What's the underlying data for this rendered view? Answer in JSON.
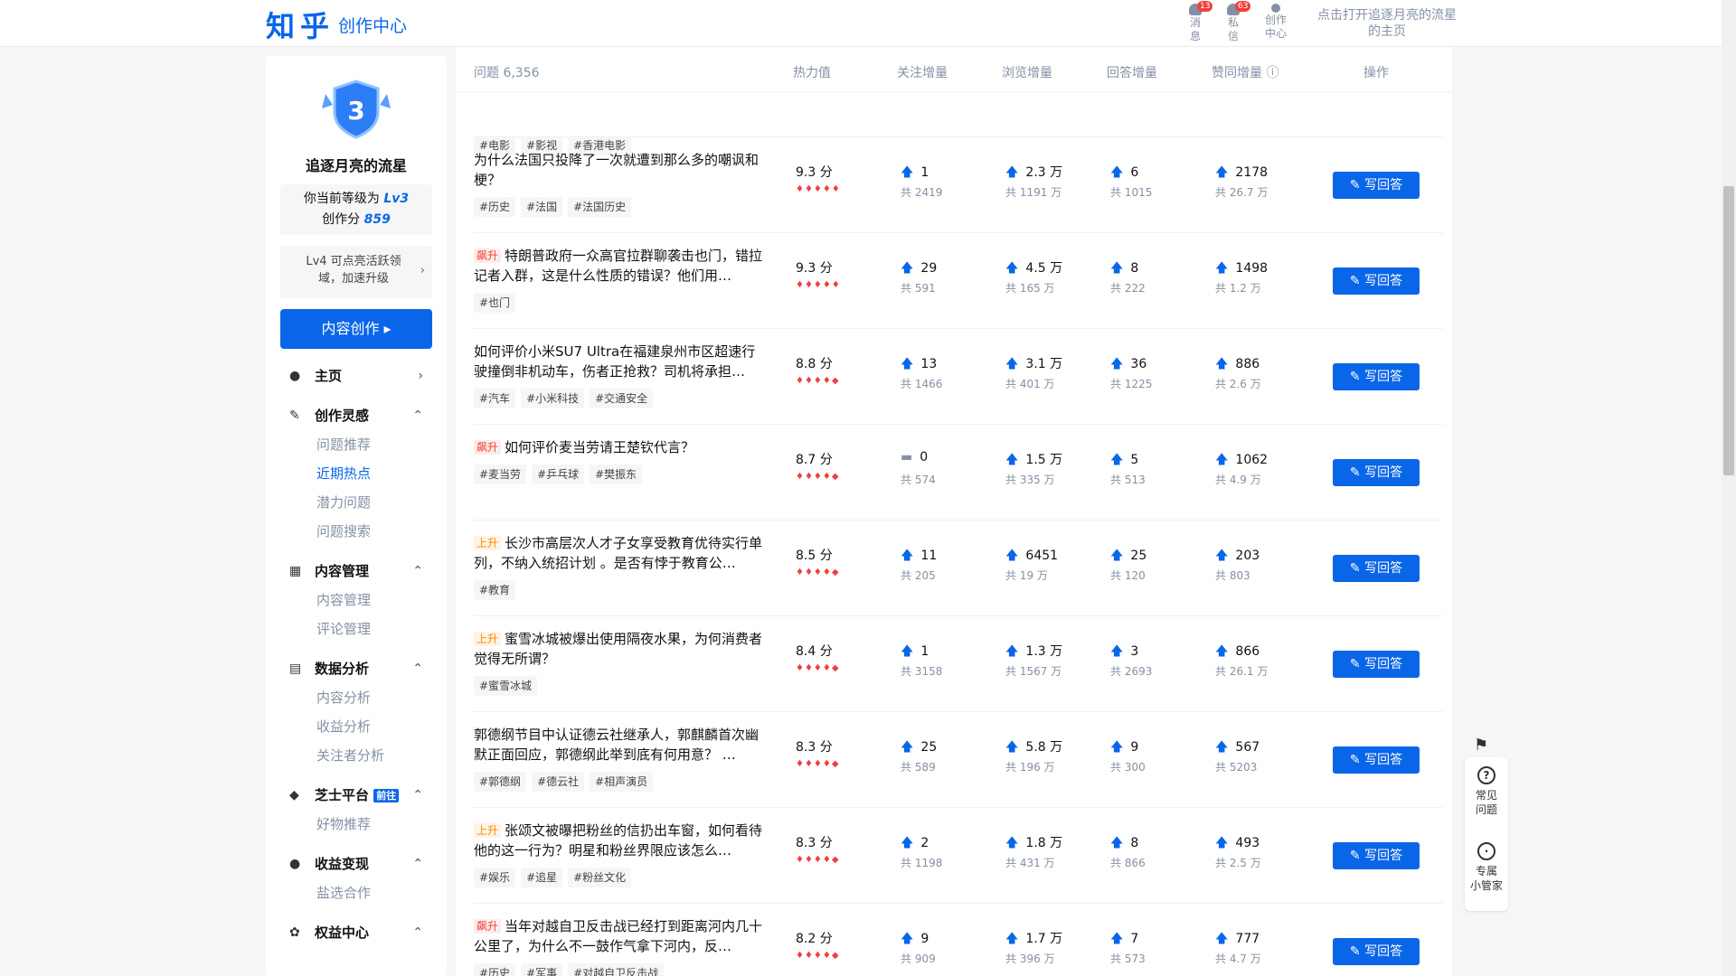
{
  "header": {
    "logo": "知乎",
    "subtitle": "创作中心",
    "icons": [
      {
        "label": "消\n息",
        "badge": "13"
      },
      {
        "label": "私\n信",
        "badge": "63"
      },
      {
        "label": "创作\n中心",
        "badge": ""
      }
    ],
    "avatar_alt": "点击打开追逐月亮的流星的主页"
  },
  "sidebar": {
    "level_badge": "3",
    "username": "追逐月亮的流星",
    "level_line_prefix": "你当前等级为",
    "level_value": "Lv3",
    "score_prefix": "创作分",
    "score_value": "859",
    "hint": "Lv4 可点亮活跃领域，加速升级",
    "create_button": "内容创作 ▸",
    "sections": [
      {
        "title": "主页",
        "icon": "person-icon",
        "chevron": "›",
        "items": []
      },
      {
        "title": "创作灵感",
        "icon": "pen-icon",
        "chevron": "⌃",
        "items": [
          "问题推荐",
          "近期热点",
          "潜力问题",
          "问题搜索"
        ]
      },
      {
        "title": "内容管理",
        "icon": "grid-icon",
        "chevron": "⌃",
        "items": [
          "内容管理",
          "评论管理"
        ]
      },
      {
        "title": "数据分析",
        "icon": "chart-icon",
        "chevron": "⌃",
        "items": [
          "内容分析",
          "收益分析",
          "关注者分析"
        ]
      },
      {
        "title": "芝士平台",
        "icon": "cheese-icon",
        "chevron": "⌃",
        "tag": "前往",
        "items": [
          "好物推荐"
        ]
      },
      {
        "title": "收益变现",
        "icon": "money-icon",
        "chevron": "⌃",
        "items": [
          "盐选合作"
        ]
      },
      {
        "title": "权益中心",
        "icon": "lotus-icon",
        "chevron": "⌃",
        "items": []
      }
    ],
    "active_item": "近期热点"
  },
  "table": {
    "headers": [
      "问题 6,356",
      "热力值",
      "关注增量",
      "浏览增量",
      "回答增量",
      "赞同增量 ⓘ",
      "操作"
    ],
    "top_tags": [
      "#电影",
      "#影视",
      "#香港电影"
    ],
    "write_label": "写回答",
    "rows": [
      {
        "badge": "",
        "title": "为什么法国只投降了一次就遭到那么多的嘲讽和梗？",
        "tags": [
          "#历史",
          "#法国",
          "#法国历史"
        ],
        "score": "9.3 分",
        "flames": "♦♦♦♦♦",
        "follow": "1",
        "follow_total": "共 2419",
        "follow_flat": false,
        "view": "2.3 万",
        "view_total": "共 1191 万",
        "answer": "6",
        "answer_total": "共 1015",
        "vote": "2178",
        "vote_total": "共 26.7 万"
      },
      {
        "badge": "飙升",
        "badge_type": "up",
        "title": "特朗普政府一众高官拉群聊袭击也门，错拉记者入群，这是什么性质的错误？他们用…",
        "tags": [
          "#也门"
        ],
        "score": "9.3 分",
        "flames": "♦♦♦♦♦",
        "follow": "29",
        "follow_total": "共 591",
        "follow_flat": false,
        "view": "4.5 万",
        "view_total": "共 165 万",
        "answer": "8",
        "answer_total": "共 222",
        "vote": "1498",
        "vote_total": "共 1.2 万"
      },
      {
        "badge": "",
        "title": "如何评价小米SU7 Ultra在福建泉州市区超速行驶撞倒非机动车，伤者正抢救？司机将承担…",
        "tags": [
          "#汽车",
          "#小米科技",
          "#交通安全"
        ],
        "score": "8.8 分",
        "flames": "♦♦♦♦◆",
        "follow": "13",
        "follow_total": "共 1466",
        "follow_flat": false,
        "view": "3.1 万",
        "view_total": "共 401 万",
        "answer": "36",
        "answer_total": "共 1225",
        "vote": "886",
        "vote_total": "共 2.6 万"
      },
      {
        "badge": "飙升",
        "badge_type": "up",
        "title": "如何评价麦当劳请王楚钦代言？",
        "tags": [
          "#麦当劳",
          "#乒乓球",
          "#樊振东"
        ],
        "score": "8.7 分",
        "flames": "♦♦♦♦◆",
        "follow": "0",
        "follow_total": "共 574",
        "follow_flat": true,
        "view": "1.5 万",
        "view_total": "共 335 万",
        "answer": "5",
        "answer_total": "共 513",
        "vote": "1062",
        "vote_total": "共 4.9 万"
      },
      {
        "badge": "上升",
        "badge_type": "rise",
        "title": "长沙市高层次人才子女享受教育优待实行单列，不纳入统招计划 。是否有悖于教育公…",
        "tags": [
          "#教育"
        ],
        "score": "8.5 分",
        "flames": "♦♦♦♦◆",
        "follow": "11",
        "follow_total": "共 205",
        "follow_flat": false,
        "view": "6451",
        "view_total": "共 19 万",
        "answer": "25",
        "answer_total": "共 120",
        "vote": "203",
        "vote_total": "共 803"
      },
      {
        "badge": "上升",
        "badge_type": "rise",
        "title": "蜜雪冰城被爆出使用隔夜水果，为何消费者觉得无所谓？",
        "tags": [
          "#蜜雪冰城"
        ],
        "score": "8.4 分",
        "flames": "♦♦♦♦◆",
        "follow": "1",
        "follow_total": "共 3158",
        "follow_flat": false,
        "view": "1.3 万",
        "view_total": "共 1567 万",
        "answer": "3",
        "answer_total": "共 2693",
        "vote": "866",
        "vote_total": "共 26.1 万"
      },
      {
        "badge": "",
        "title": "郭德纲节目中认证德云社继承人，郭麒麟首次幽默正面回应，郭德纲此举到底有何用意？ …",
        "tags": [
          "#郭德纲",
          "#德云社",
          "#相声演员"
        ],
        "score": "8.3 分",
        "flames": "♦♦♦♦◆",
        "follow": "25",
        "follow_total": "共 589",
        "follow_flat": false,
        "view": "5.8 万",
        "view_total": "共 196 万",
        "answer": "9",
        "answer_total": "共 300",
        "vote": "567",
        "vote_total": "共 5203"
      },
      {
        "badge": "上升",
        "badge_type": "rise",
        "title": "张颂文被曝把粉丝的信扔出车窗，如何看待他的这一行为？明星和粉丝界限应该怎么…",
        "tags": [
          "#娱乐",
          "#追星",
          "#粉丝文化"
        ],
        "score": "8.3 分",
        "flames": "♦♦♦♦◆",
        "follow": "2",
        "follow_total": "共 1198",
        "follow_flat": false,
        "view": "1.8 万",
        "view_total": "共 431 万",
        "answer": "8",
        "answer_total": "共 866",
        "vote": "493",
        "vote_total": "共 2.5 万"
      },
      {
        "badge": "飙升",
        "badge_type": "up",
        "title": "当年对越自卫反击战已经打到距离河内几十公里了，为什么不一鼓作气拿下河内，反…",
        "tags": [
          "#历史",
          "#军事",
          "#对越自卫反击战"
        ],
        "score": "8.2 分",
        "flames": "♦♦♦♦◆",
        "follow": "9",
        "follow_total": "共 909",
        "follow_flat": false,
        "view": "1.7 万",
        "view_total": "共 396 万",
        "answer": "7",
        "answer_total": "共 573",
        "vote": "777",
        "vote_total": "共 4.7 万"
      }
    ]
  },
  "float_panel": {
    "help": "常见\n问题",
    "butler": "专属\n小管家"
  },
  "colors": {
    "brand": "#0a66e8",
    "hot": "#f1403c",
    "rise": "#ff8a00"
  }
}
